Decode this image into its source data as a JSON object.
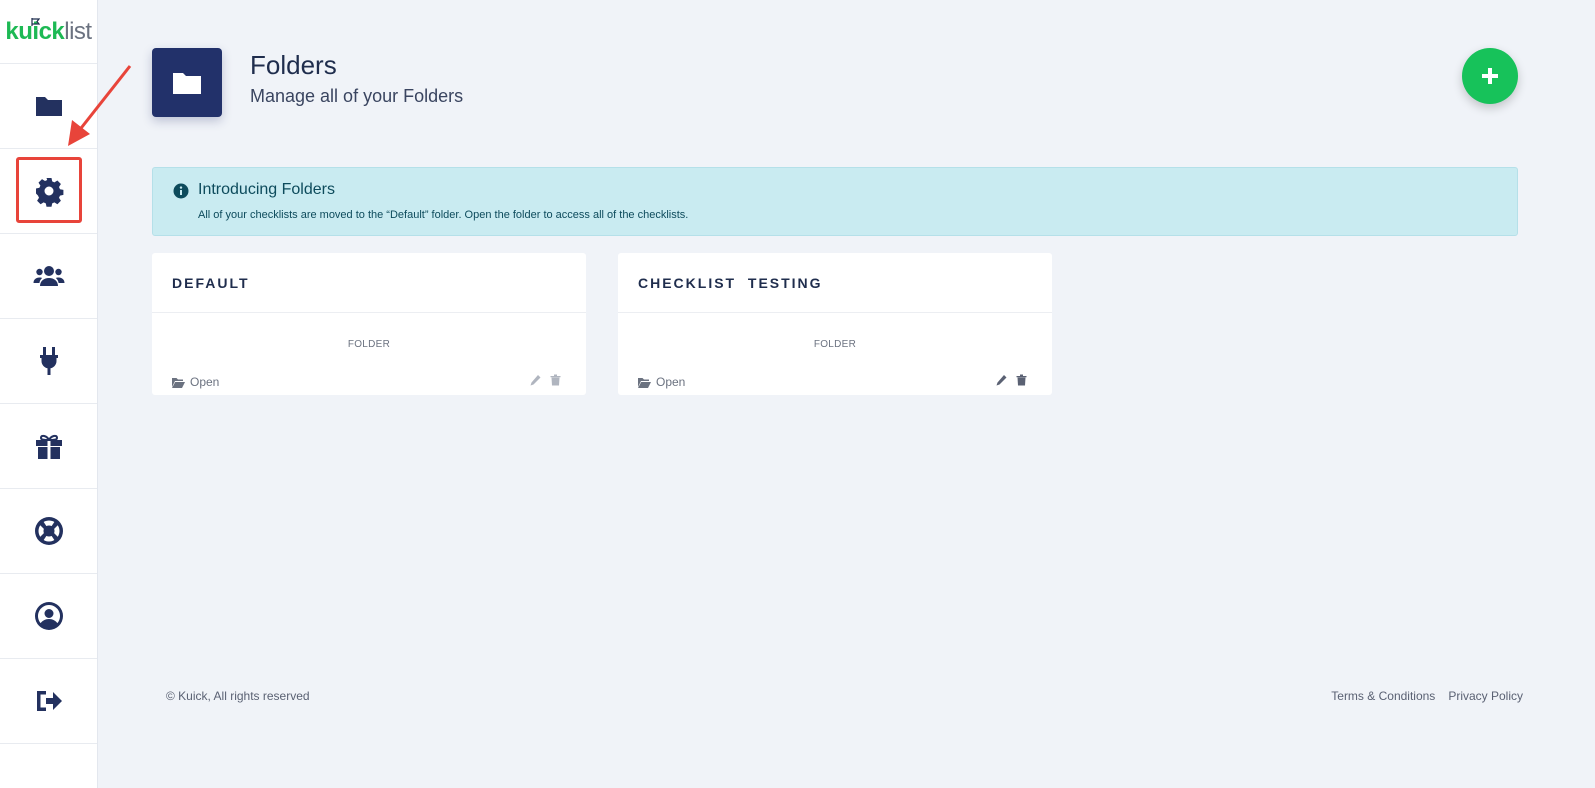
{
  "brand": {
    "logo_part1": "kuick",
    "logo_part2": "list",
    "accent": "#1db954"
  },
  "sidebar": {
    "items": [
      {
        "icon": "folder-icon"
      },
      {
        "icon": "gear-icon"
      },
      {
        "icon": "users-icon"
      },
      {
        "icon": "plug-icon"
      },
      {
        "icon": "gift-icon"
      },
      {
        "icon": "life-ring-icon"
      },
      {
        "icon": "user-circle-icon"
      },
      {
        "icon": "sign-out-icon"
      }
    ],
    "highlighted_item": "gear-icon",
    "highlight_color": "#e8443a"
  },
  "header": {
    "title": "Folders",
    "subtitle": "Manage all of your Folders",
    "icon": "folder-icon",
    "add_button_icon": "plus-icon",
    "add_button_color": "#17c25a"
  },
  "alert": {
    "title": "Introducing Folders",
    "text": "All of your checklists are moved to the “Default” folder. Open the folder to access all of the checklists.",
    "icon": "info-circle-icon"
  },
  "folders": [
    {
      "name": "DEFAULT",
      "type": "FOLDER",
      "open_label": "Open"
    },
    {
      "name": "CHECKLIST  TESTING",
      "type": "FOLDER",
      "open_label": "Open"
    }
  ],
  "footer": {
    "copyright": "© Kuick, All rights reserved",
    "links": [
      "Terms & Conditions",
      "Privacy Policy"
    ]
  }
}
